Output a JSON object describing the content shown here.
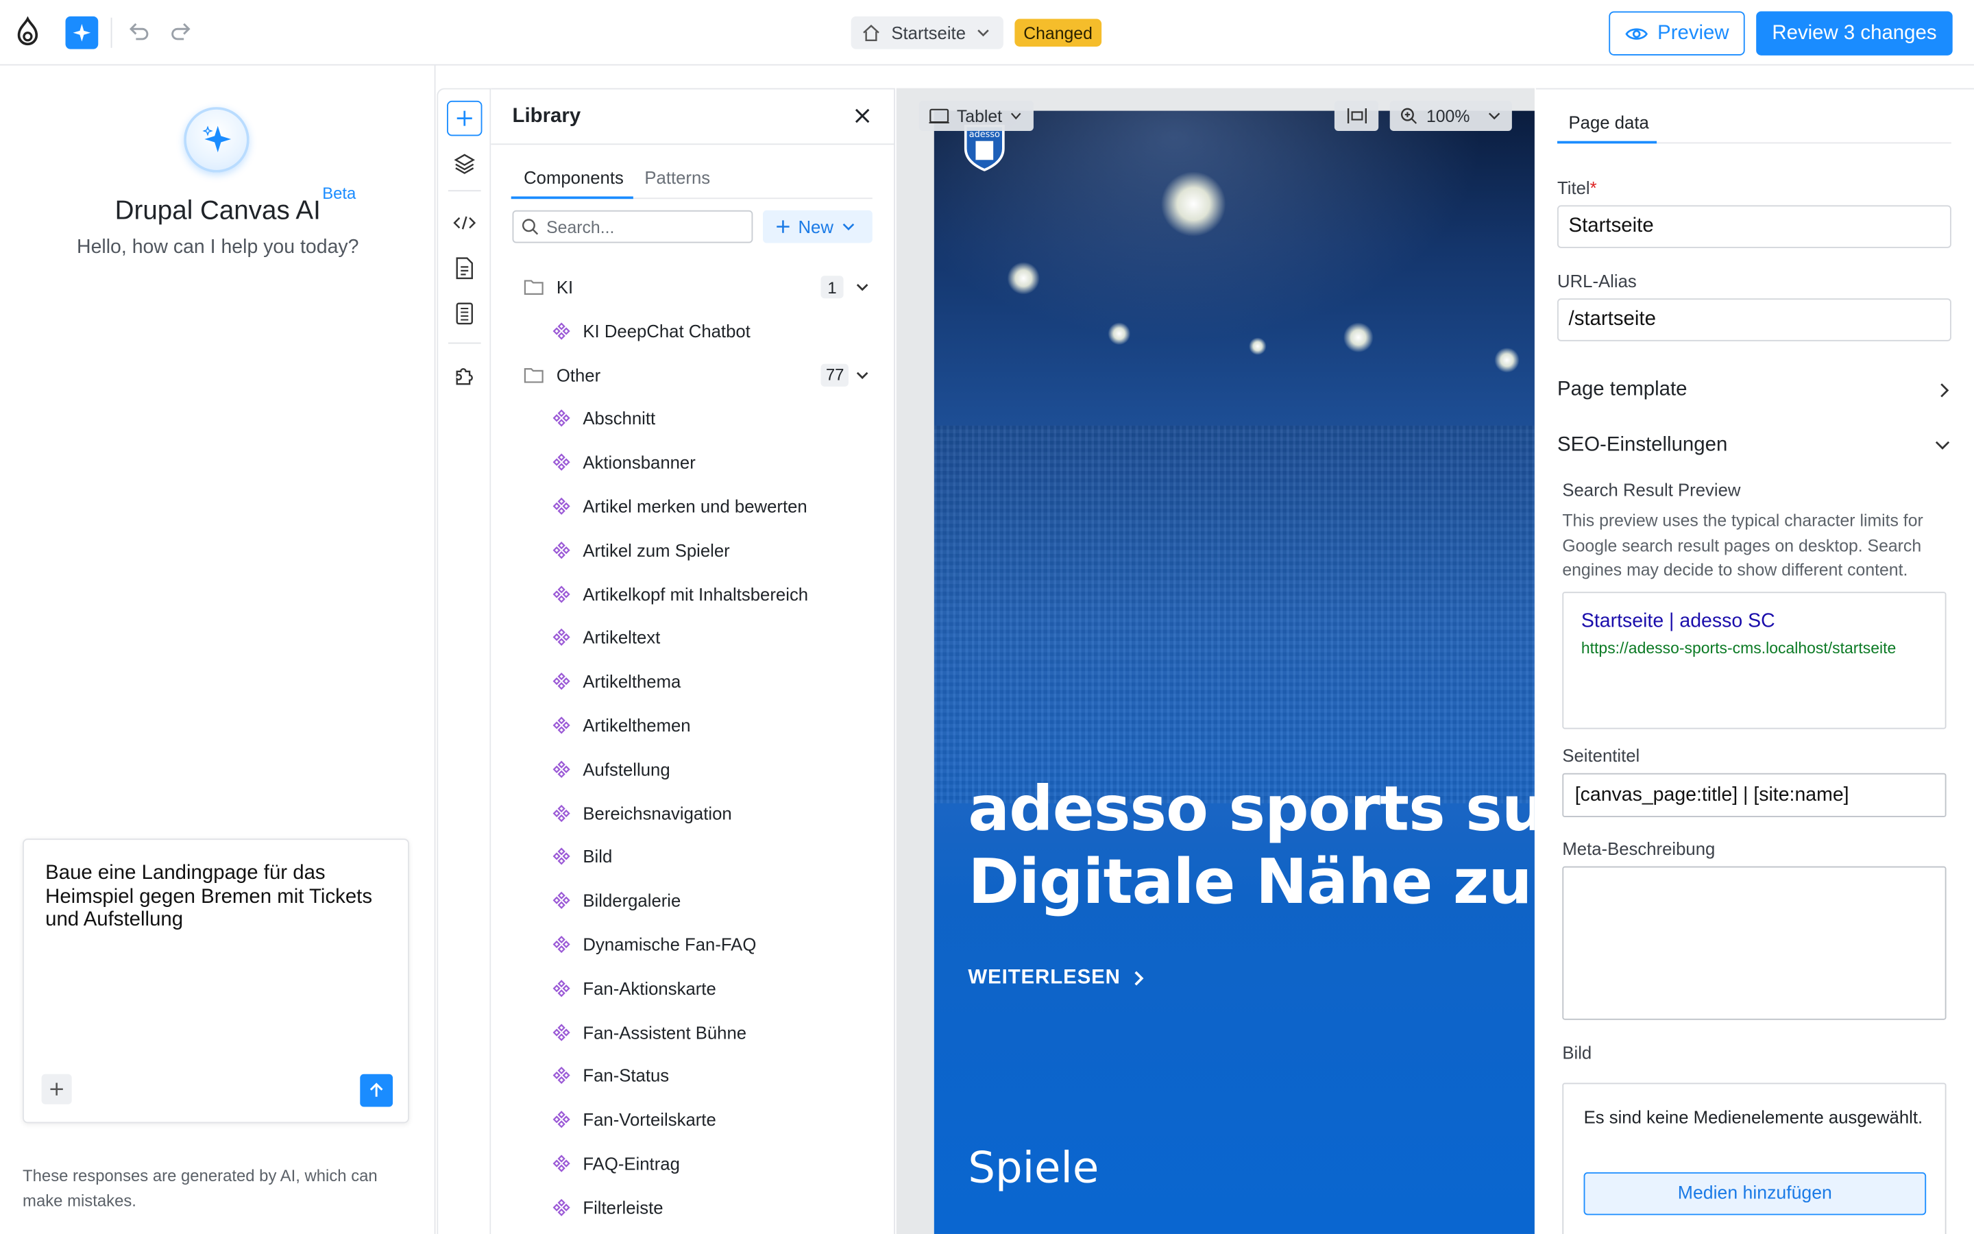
{
  "topbar": {
    "page_name": "Startseite",
    "status_badge": "Changed",
    "preview_label": "Preview",
    "review_label": "Review 3 changes"
  },
  "ai_panel": {
    "title": "Drupal Canvas AI",
    "beta_label": "Beta",
    "subtitle": "Hello, how can I help you today?",
    "prompt_text": "Baue eine Landingpage für das Heimspiel gegen Bremen mit Tickets und Aufstellung",
    "disclaimer": "These responses are generated by AI, which can make mistakes."
  },
  "library": {
    "title": "Library",
    "tabs": [
      {
        "label": "Components",
        "active": true
      },
      {
        "label": "Patterns",
        "active": false
      }
    ],
    "search_placeholder": "Search...",
    "new_label": "New",
    "groups": [
      {
        "name": "KI",
        "count": "1",
        "items": [
          "KI DeepChat Chatbot"
        ]
      },
      {
        "name": "Other",
        "count": "77",
        "items": [
          "Abschnitt",
          "Aktionsbanner",
          "Artikel merken und bewerten",
          "Artikel zum Spieler",
          "Artikelkopf mit Inhaltsbereich",
          "Artikeltext",
          "Artikelthema",
          "Artikelthemen",
          "Aufstellung",
          "Bereichsnavigation",
          "Bild",
          "Bildergalerie",
          "Dynamische Fan-FAQ",
          "Fan-Aktionskarte",
          "Fan-Assistent Bühne",
          "Fan-Status",
          "Fan-Vorteilskarte",
          "FAQ-Eintrag",
          "Filterleiste"
        ]
      }
    ]
  },
  "canvas": {
    "device_label": "Tablet",
    "zoom_label": "100%",
    "logo_text": "adesso",
    "hero_line1": "adesso sports summ",
    "hero_line2": "Digitale Nähe zum",
    "hero_link": "WEITERLESEN",
    "section_title": "Spiele"
  },
  "page_data": {
    "tab_label": "Page data",
    "title_label": "Titel",
    "title_required_mark": "*",
    "title_value": "Startseite",
    "alias_label": "URL-Alias",
    "alias_value": "/startseite",
    "template_label": "Page template",
    "seo_label": "SEO-Einstellungen",
    "serp_label": "Search Result Preview",
    "serp_help": "This preview uses the typical character limits for Google search result pages on desktop. Search engines may decide to show different content.",
    "serp_title": "Startseite | adesso SC",
    "serp_url": "https://adesso-sports-cms.localhost/startseite",
    "seitentitel_label": "Seitentitel",
    "seitentitel_value": "[canvas_page:title] | [site:name]",
    "meta_label": "Meta-Beschreibung",
    "meta_value": "",
    "bild_label": "Bild",
    "media_empty_text": "Es sind keine Medienelemente ausgewählt.",
    "media_button": "Medien hinzufügen"
  },
  "colors": {
    "accent": "#1a8cff",
    "changed_badge": "#f5bd2b",
    "component_icon": "#9b5ad6"
  }
}
